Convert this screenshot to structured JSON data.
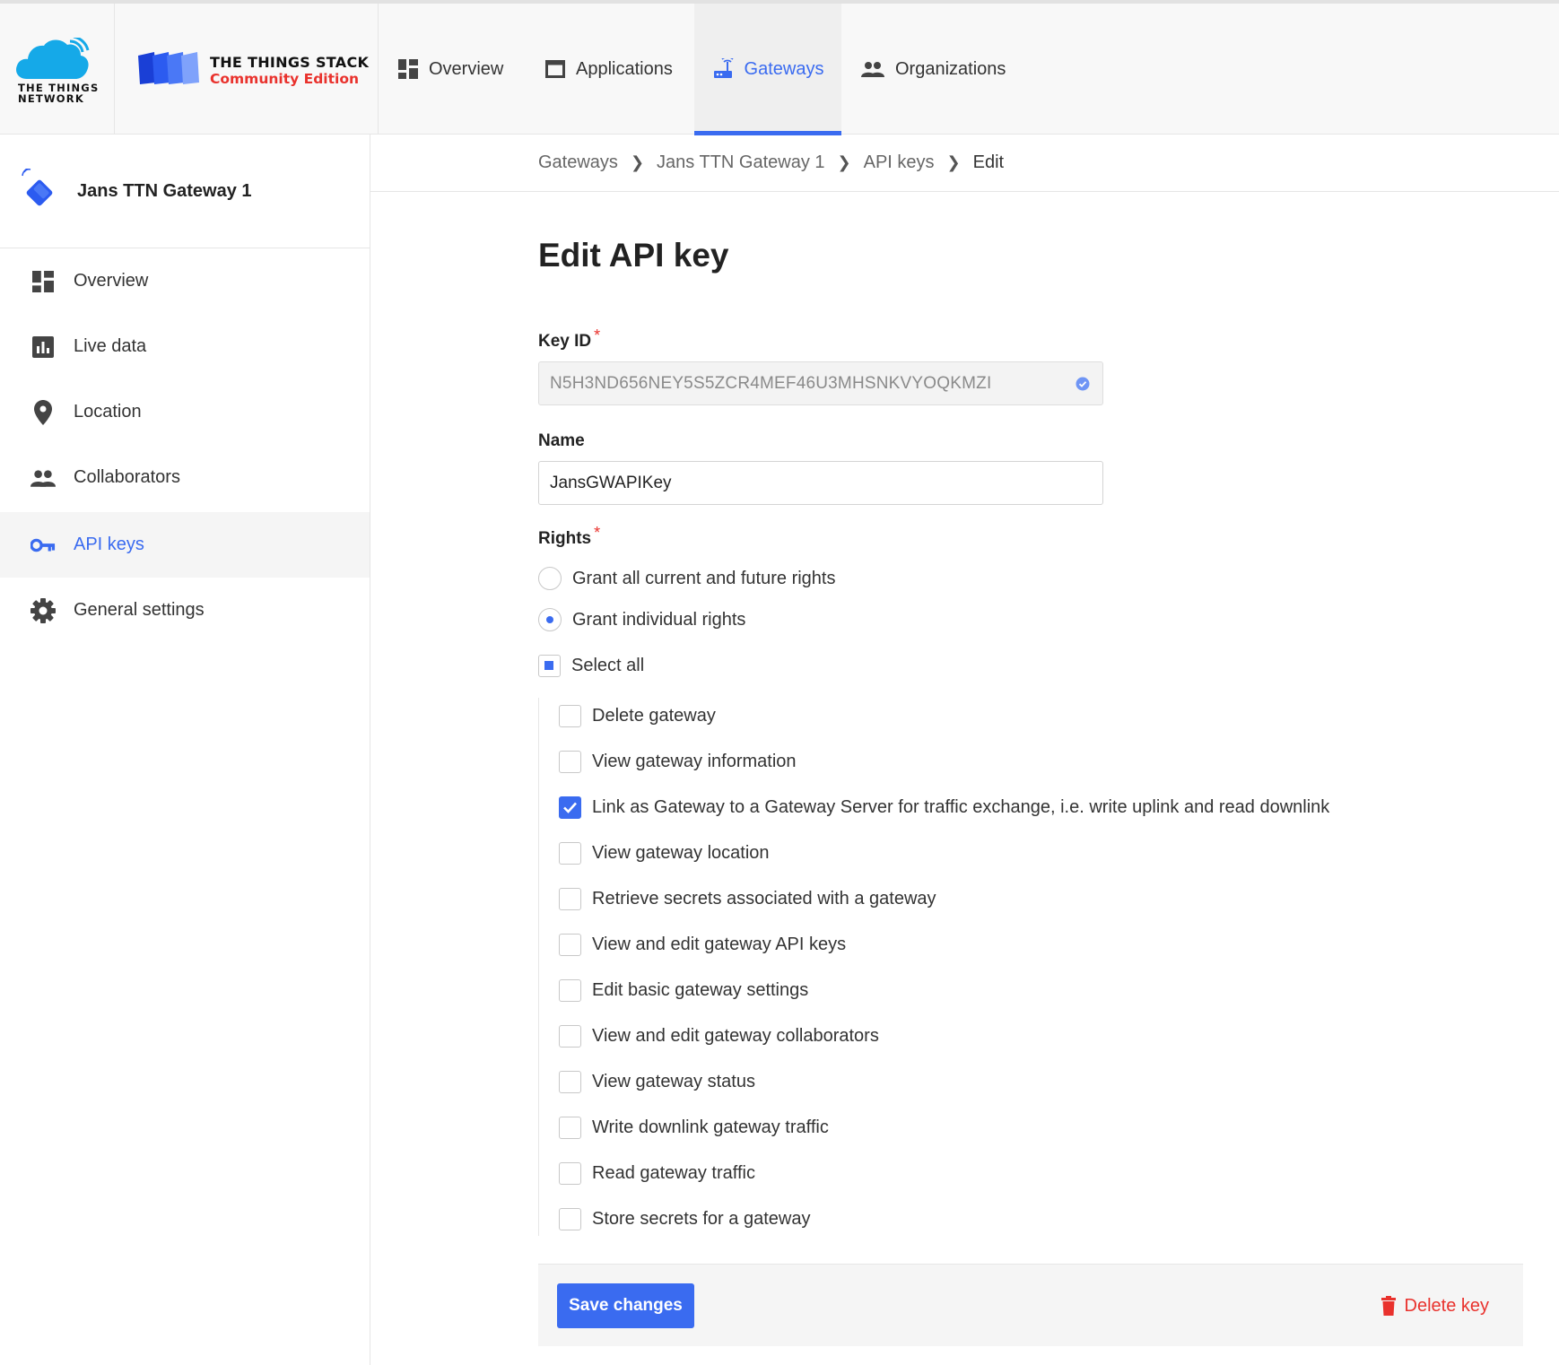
{
  "brand": {
    "network_line1": "THE THINGS",
    "network_line2": "NETWORK",
    "stack_title": "THE THINGS STACK",
    "stack_edition": "Community Edition",
    "accent_color": "#3a6bf0",
    "danger_color": "#e9322d"
  },
  "topnav": {
    "items": [
      {
        "label": "Overview",
        "icon": "dashboard-icon"
      },
      {
        "label": "Applications",
        "icon": "window-icon"
      },
      {
        "label": "Gateways",
        "icon": "gateway-router-icon",
        "active": true
      },
      {
        "label": "Organizations",
        "icon": "people-icon"
      }
    ]
  },
  "sidebar": {
    "gateway_name": "Jans TTN Gateway 1",
    "items": [
      {
        "label": "Overview",
        "icon": "dashboard-icon"
      },
      {
        "label": "Live data",
        "icon": "bar-chart-icon"
      },
      {
        "label": "Location",
        "icon": "location-pin-icon"
      },
      {
        "label": "Collaborators",
        "icon": "people-icon"
      },
      {
        "label": "API keys",
        "icon": "key-icon",
        "active": true
      },
      {
        "label": "General settings",
        "icon": "gear-icon"
      }
    ]
  },
  "breadcrumb": [
    "Gateways",
    "Jans TTN Gateway 1",
    "API keys",
    "Edit"
  ],
  "form": {
    "title": "Edit API key",
    "key_id": {
      "label": "Key ID",
      "value": "N5H3ND656NEY5S5ZCR4MEF46U3MHSNKVYOQKMZI"
    },
    "name": {
      "label": "Name",
      "value": "JansGWAPIKey"
    },
    "rights": {
      "label": "Rights",
      "required_mark": "*",
      "options": [
        "Grant all current and future rights",
        "Grant individual rights"
      ],
      "selected_option": "Grant individual rights",
      "select_all": "Select all",
      "items": [
        {
          "label": "Delete gateway",
          "checked": false
        },
        {
          "label": "View gateway information",
          "checked": false
        },
        {
          "label": "Link as Gateway to a Gateway Server for traffic exchange, i.e. write uplink and read downlink",
          "checked": true
        },
        {
          "label": "View gateway location",
          "checked": false
        },
        {
          "label": "Retrieve secrets associated with a gateway",
          "checked": false
        },
        {
          "label": "View and edit gateway API keys",
          "checked": false
        },
        {
          "label": "Edit basic gateway settings",
          "checked": false
        },
        {
          "label": "View and edit gateway collaborators",
          "checked": false
        },
        {
          "label": "View gateway status",
          "checked": false
        },
        {
          "label": "Write downlink gateway traffic",
          "checked": false
        },
        {
          "label": "Read gateway traffic",
          "checked": false
        },
        {
          "label": "Store secrets for a gateway",
          "checked": false
        }
      ]
    },
    "save_label": "Save changes",
    "delete_label": "Delete key"
  }
}
